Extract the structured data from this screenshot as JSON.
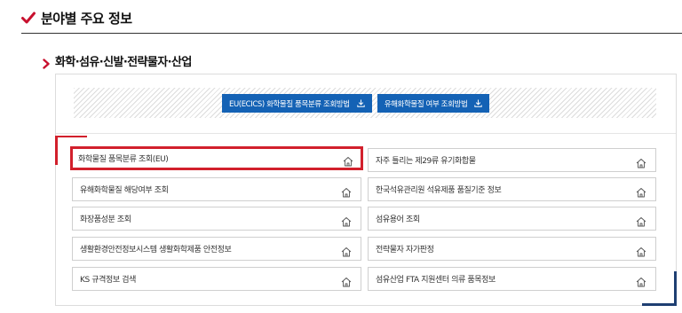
{
  "section": {
    "title": "분야별 주요 정보",
    "check_icon": "check-icon",
    "accent_color": "#c8102e"
  },
  "subsection": {
    "title": "화학·섬유·신발·전략물자·산업",
    "chevron_icon": "chevron-right-icon"
  },
  "buttons": [
    {
      "label": "EU(ECICS) 화학물질 품목분류 조회방법",
      "icon": "download-icon"
    },
    {
      "label": "유해화학물질 여부 조회방법",
      "icon": "download-icon"
    }
  ],
  "links": [
    {
      "label": "화학물질 품목분류 조회(EU)",
      "icon": "home-icon",
      "active": true
    },
    {
      "label": "자주 틀리는 제29류 유기화합물",
      "icon": "home-icon",
      "active": false
    },
    {
      "label": "유해화학물질 해당여부 조회",
      "icon": "home-icon",
      "active": false
    },
    {
      "label": "한국석유관리원 석유제품 품질기준 정보",
      "icon": "home-icon",
      "active": false
    },
    {
      "label": "화장품성분 조회",
      "icon": "home-icon",
      "active": false
    },
    {
      "label": "섬유용어 조회",
      "icon": "home-icon",
      "active": false
    },
    {
      "label": "생활환경안전정보시스템 생활화학제품 안전정보",
      "icon": "home-icon",
      "active": false
    },
    {
      "label": "전략물자 자가판정",
      "icon": "home-icon",
      "active": false
    },
    {
      "label": "KS 규격정보 검색",
      "icon": "home-icon",
      "active": false
    },
    {
      "label": "섬유산업 FTA 지원센터 의류 품목정보",
      "icon": "home-icon",
      "active": false
    }
  ],
  "colors": {
    "button_blue": "#1462b5",
    "highlight_red": "#d2202c",
    "corner_navy": "#1e3f72"
  }
}
